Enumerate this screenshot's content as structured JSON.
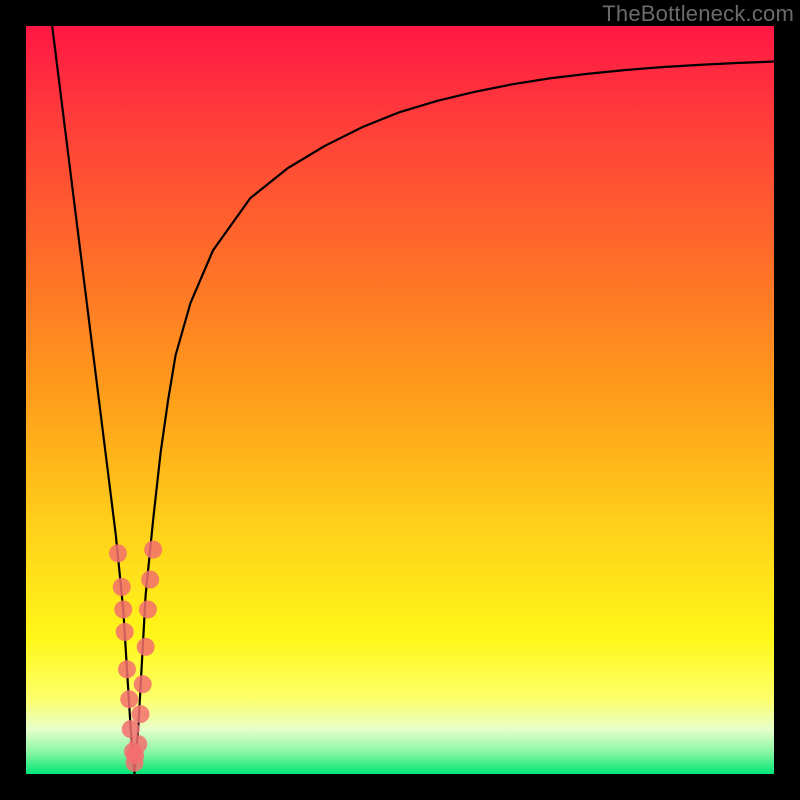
{
  "watermark": "TheBottleneck.com",
  "chart_data": {
    "type": "line",
    "title": "",
    "xlabel": "",
    "ylabel": "",
    "ylim": [
      0,
      100
    ],
    "xlim": [
      0,
      100
    ],
    "series": [
      {
        "name": "bottleneck-curve",
        "x": [
          3.5,
          4,
          5,
          6,
          7,
          8,
          9,
          10,
          11,
          12,
          13,
          13.5,
          14,
          14.5,
          15,
          15.5,
          16,
          17,
          18,
          19,
          20,
          22,
          25,
          30,
          35,
          40,
          45,
          50,
          55,
          60,
          65,
          70,
          75,
          80,
          85,
          90,
          95,
          100
        ],
        "y": [
          100,
          96,
          88,
          80,
          72,
          64,
          56,
          48,
          40,
          32,
          22,
          14,
          6,
          0,
          6,
          15,
          24,
          34,
          43,
          50,
          56,
          63,
          70,
          77,
          81,
          84,
          86.5,
          88.5,
          90,
          91.2,
          92.2,
          93,
          93.6,
          94.1,
          94.5,
          94.8,
          95.05,
          95.25
        ]
      }
    ],
    "scatter_points": [
      {
        "x": 12.3,
        "y": 29.5
      },
      {
        "x": 12.8,
        "y": 25
      },
      {
        "x": 13.0,
        "y": 22
      },
      {
        "x": 13.2,
        "y": 19
      },
      {
        "x": 13.5,
        "y": 14
      },
      {
        "x": 13.8,
        "y": 10
      },
      {
        "x": 14.0,
        "y": 6
      },
      {
        "x": 14.3,
        "y": 3
      },
      {
        "x": 14.5,
        "y": 1.5
      },
      {
        "x": 14.6,
        "y": 2.5
      },
      {
        "x": 15.0,
        "y": 4
      },
      {
        "x": 15.3,
        "y": 8
      },
      {
        "x": 15.6,
        "y": 12
      },
      {
        "x": 16.0,
        "y": 17
      },
      {
        "x": 16.3,
        "y": 22
      },
      {
        "x": 16.6,
        "y": 26
      },
      {
        "x": 17.0,
        "y": 30
      }
    ],
    "colors": {
      "curve": "#000000",
      "points": "#f36f6f",
      "gradient_top": "#ff1744",
      "gradient_bottom": "#00e676"
    }
  }
}
